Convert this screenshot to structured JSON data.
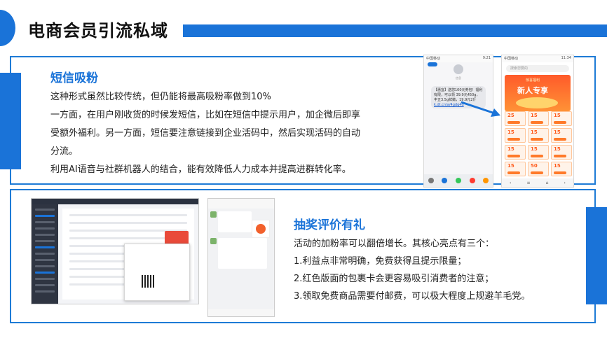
{
  "header": {
    "title": "电商会员引流私域"
  },
  "section_sms": {
    "title": "短信吸粉",
    "lines": [
      "这种形式虽然比较传统，但仍能将最高吸粉率做到10%",
      "一方面，在用户刚收货的时候发短信，比如在短信中提示用户，加企微后即享",
      "受额外福利。另一方面，短信要注意链接到企业活码中，然后实现活码的自动",
      "分流。",
      "利用AI语音与社群机器人的结合，能有效降低人力成本并提高进群转化率。"
    ]
  },
  "section_lottery": {
    "title": "抽奖评价有礼",
    "lines": [
      "活动的加粉率可以翻倍增长。其核心亮点有三个：",
      "1.利益点非常明确，免费获得且提示限量；",
      "2.红色版面的包裹卡会更容易吸引消费者的注意；",
      "3.领取免费商品需要付邮费，可以极大程度上规避羊毛党。"
    ]
  },
  "phone_sms": {
    "sms_text": "【惠宜】送您100元券包！福利有限，可以领 39.9元450g，丰五3.5g鲜嫩，19.9元2斤",
    "link_text": "k.dt.cn/a/4gdq4d"
  },
  "phone_app": {
    "banner_top": "惊喜福利",
    "banner_title": "新人专享",
    "coupons": [
      "25",
      "15",
      "15",
      "15",
      "15",
      "15",
      "15",
      "15",
      "15",
      "15",
      "50",
      "15"
    ],
    "search_placeholder": "搜索您要的"
  },
  "colors": {
    "accent": "#1a73d8",
    "panel_border": "#1e7bd6",
    "coupon": "#ff5a1a"
  },
  "icons": [
    "arrow-icon"
  ]
}
